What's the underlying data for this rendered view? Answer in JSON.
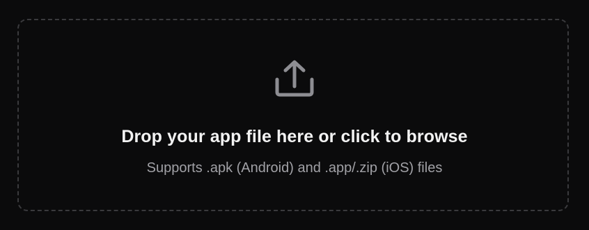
{
  "dropzone": {
    "icon": "upload-icon",
    "title": "Drop your app file here or click to browse",
    "subtitle": "Supports .apk (Android) and .app/.zip (iOS) files"
  },
  "colors": {
    "background": "#0b0b0c",
    "border": "#3a3a3d",
    "icon": "#8e8e93",
    "title": "#f2f2f2",
    "subtitle": "#a1a1a6"
  }
}
